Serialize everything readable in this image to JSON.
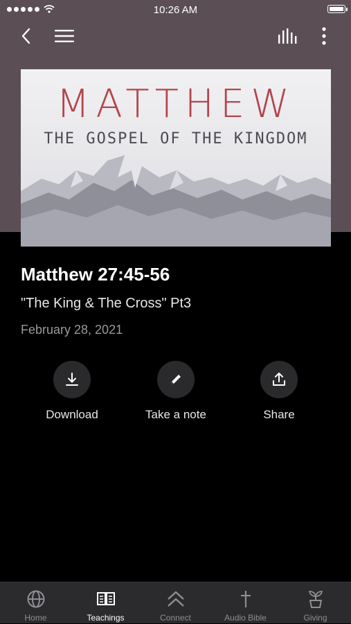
{
  "status_bar": {
    "time": "10:26 AM"
  },
  "nav": {
    "back_icon": "chevron-left-icon",
    "menu_icon": "hamburger-menu-icon",
    "audio_icon": "audio-bars-icon",
    "more_icon": "vertical-ellipsis-icon"
  },
  "artwork": {
    "title": "MATTHEW",
    "subtitle": "THE GOSPEL OF THE KINGDOM"
  },
  "sermon": {
    "title": "Matthew 27:45-56",
    "subtitle": "\"The King & The Cross\" Pt3",
    "date": "February 28, 2021"
  },
  "actions": [
    {
      "label": "Download",
      "icon": "download-icon"
    },
    {
      "label": "Take a note",
      "icon": "pencil-icon"
    },
    {
      "label": "Share",
      "icon": "share-icon"
    }
  ],
  "tabs": [
    {
      "label": "Home",
      "icon": "globe-icon",
      "active": false
    },
    {
      "label": "Teachings",
      "icon": "open-book-icon",
      "active": true
    },
    {
      "label": "Connect",
      "icon": "double-chevron-up-icon",
      "active": false
    },
    {
      "label": "Audio Bible",
      "icon": "cross-icon",
      "active": false
    },
    {
      "label": "Giving",
      "icon": "sprout-icon",
      "active": false
    }
  ],
  "colors": {
    "header_background": "#5b4f55",
    "art_title": "#b5434b",
    "tab_bar": "#2b2b2d",
    "inactive_tab": "#8e8e93"
  }
}
